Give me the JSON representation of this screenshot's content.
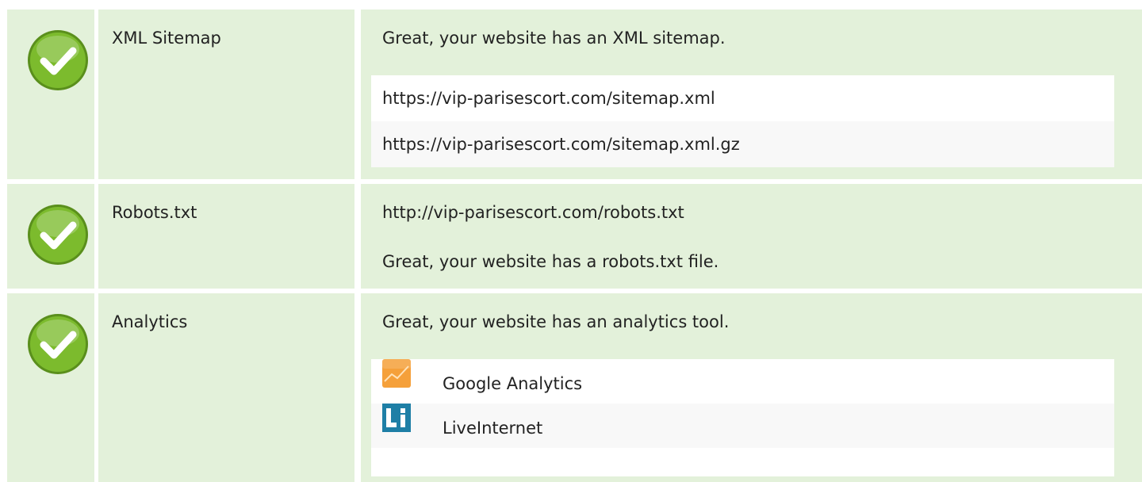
{
  "rows": [
    {
      "label": "XML Sitemap",
      "message": "Great, your website has an XML sitemap.",
      "status_icon": "check-icon",
      "items": [
        "https://vip-parisescort.com/sitemap.xml",
        "https://vip-parisescort.com/sitemap.xml.gz"
      ]
    },
    {
      "label": "Robots.txt",
      "url": "http://vip-parisescort.com/robots.txt",
      "message": "Great, your website has a robots.txt file.",
      "status_icon": "check-icon"
    },
    {
      "label": "Analytics",
      "message": "Great, your website has an analytics tool.",
      "status_icon": "check-icon",
      "tools": [
        {
          "name": "Google Analytics",
          "icon": "google-analytics-icon"
        },
        {
          "name": "LiveInternet",
          "icon": "liveinternet-icon"
        }
      ]
    }
  ],
  "colors": {
    "row_background": "#e3f1da",
    "check_green": "#7cbb2d",
    "google_analytics_orange": "#f5a03a",
    "liveinternet_teal": "#1e7fa6"
  }
}
